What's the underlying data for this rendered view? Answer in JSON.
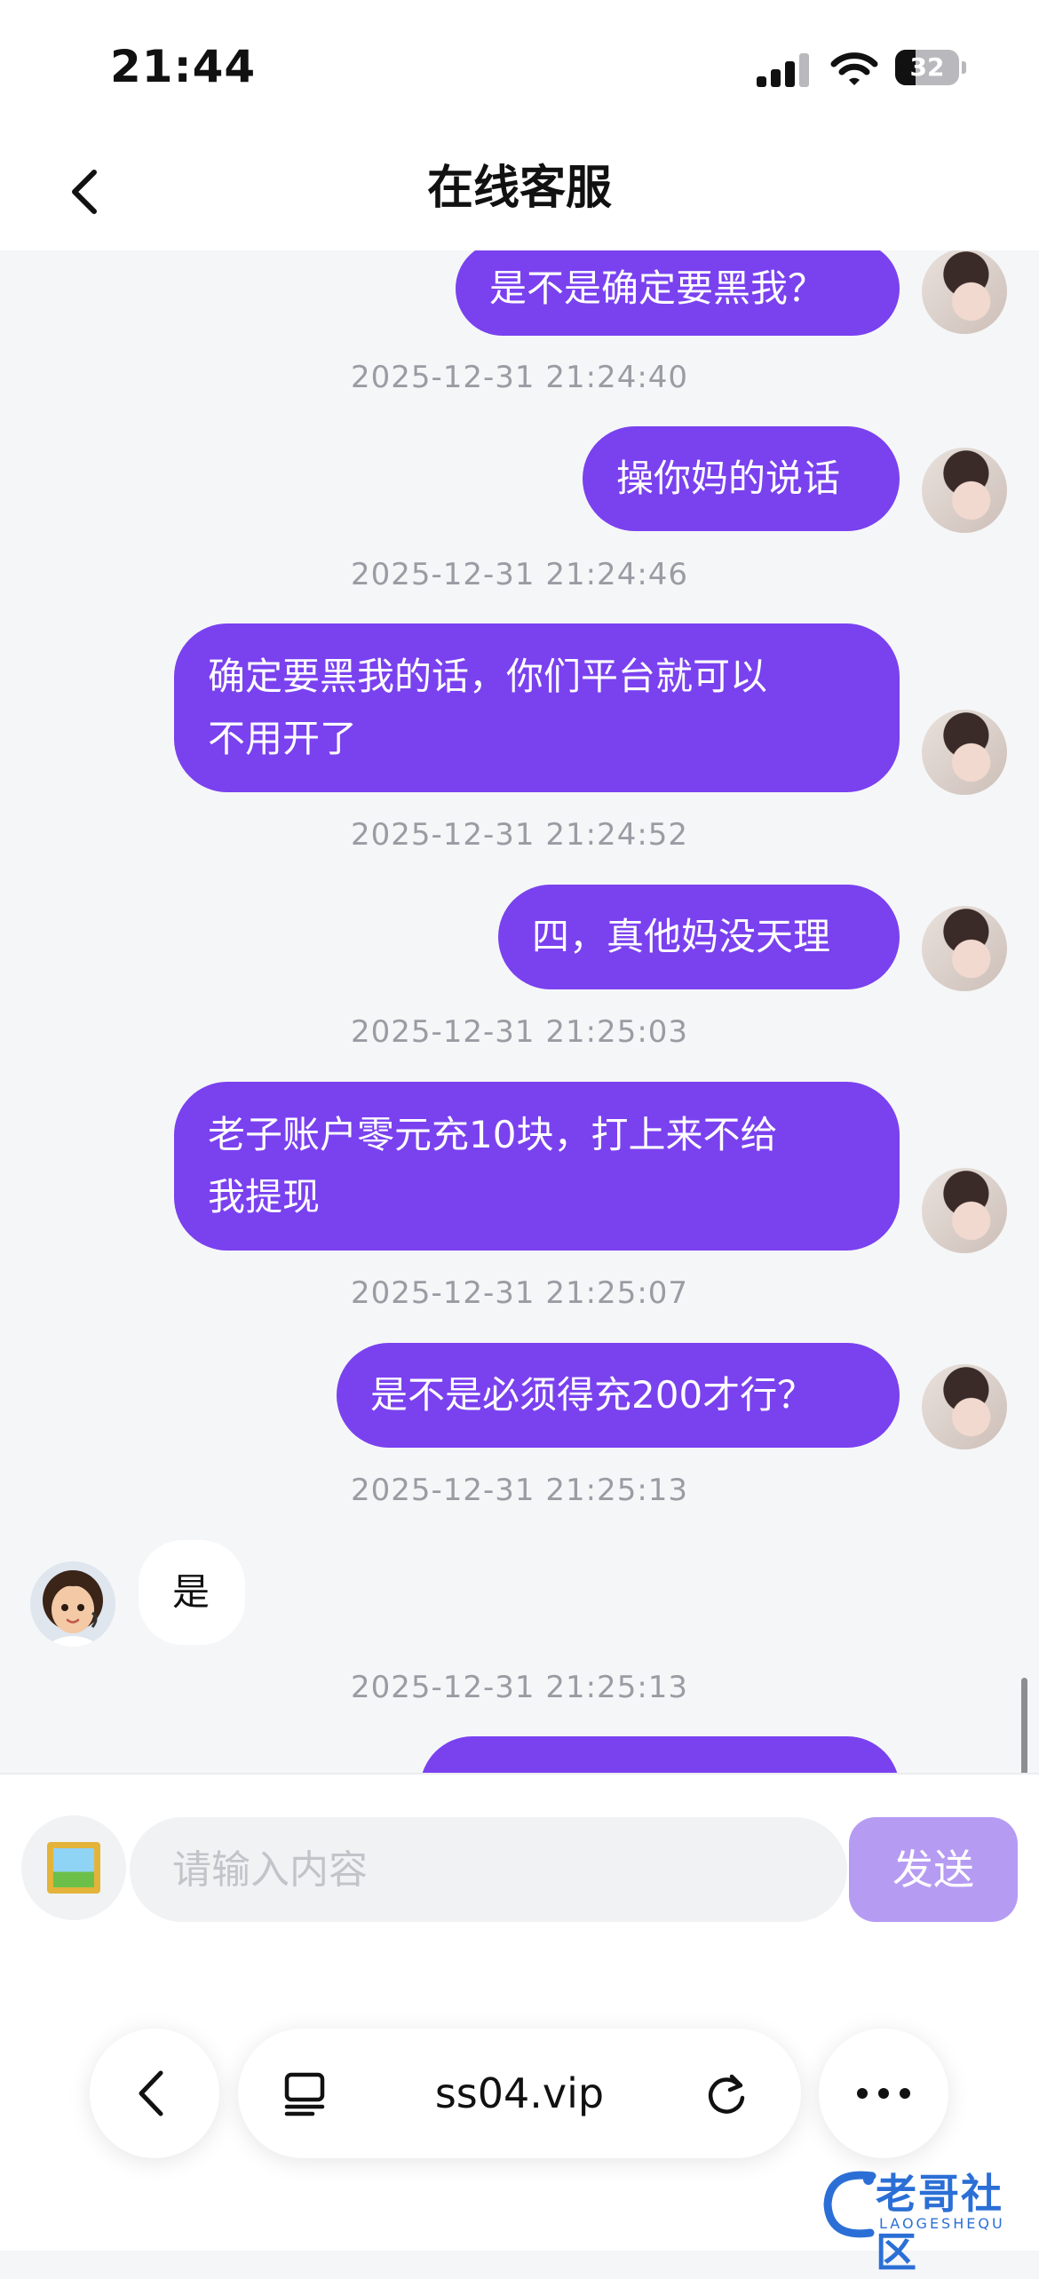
{
  "status_bar": {
    "time": "21:44",
    "battery": "32",
    "battery_level": 0.32
  },
  "nav": {
    "title": "在线客服"
  },
  "messages": [
    {
      "from": "user",
      "text": "是不是确定要黑我？"
    },
    {
      "timestamp": "2025-12-31 21:24:40"
    },
    {
      "from": "user",
      "text": "操你妈的说话"
    },
    {
      "timestamp": "2025-12-31 21:24:46"
    },
    {
      "from": "user",
      "text_lines": [
        "确定要黑我的话，你们平台就可以",
        "不用开了"
      ]
    },
    {
      "timestamp": "2025-12-31 21:24:52"
    },
    {
      "from": "user",
      "text": "四，真他妈没天理"
    },
    {
      "timestamp": "2025-12-31 21:25:03"
    },
    {
      "from": "user",
      "text_lines": [
        "老子账户零元充10块，打上来不给",
        "我提现"
      ]
    },
    {
      "timestamp": "2025-12-31 21:25:07"
    },
    {
      "from": "user",
      "text": "是不是必须得充200才行？"
    },
    {
      "timestamp": "2025-12-31 21:25:13"
    },
    {
      "from": "agent",
      "text": "是"
    },
    {
      "timestamp": "2025-12-31 21:25:13"
    },
    {
      "from": "user",
      "text": ""
    }
  ],
  "input": {
    "placeholder": "请输入内容",
    "value": "",
    "send_label": "发送"
  },
  "browser": {
    "url": "ss04.vip"
  },
  "watermark": {
    "text": "老哥社区",
    "sub": "LAOGESHEQU"
  },
  "colors": {
    "accent": "#7a41ef",
    "send_button": "#b69bf3",
    "background": "#f5f6f8",
    "timestamp": "#9a9ca3"
  },
  "icons": {
    "back": "chevron-left-icon",
    "image": "framed-picture-icon",
    "tabs": "tabs-icon",
    "reload": "reload-icon",
    "more": "more-icon"
  }
}
